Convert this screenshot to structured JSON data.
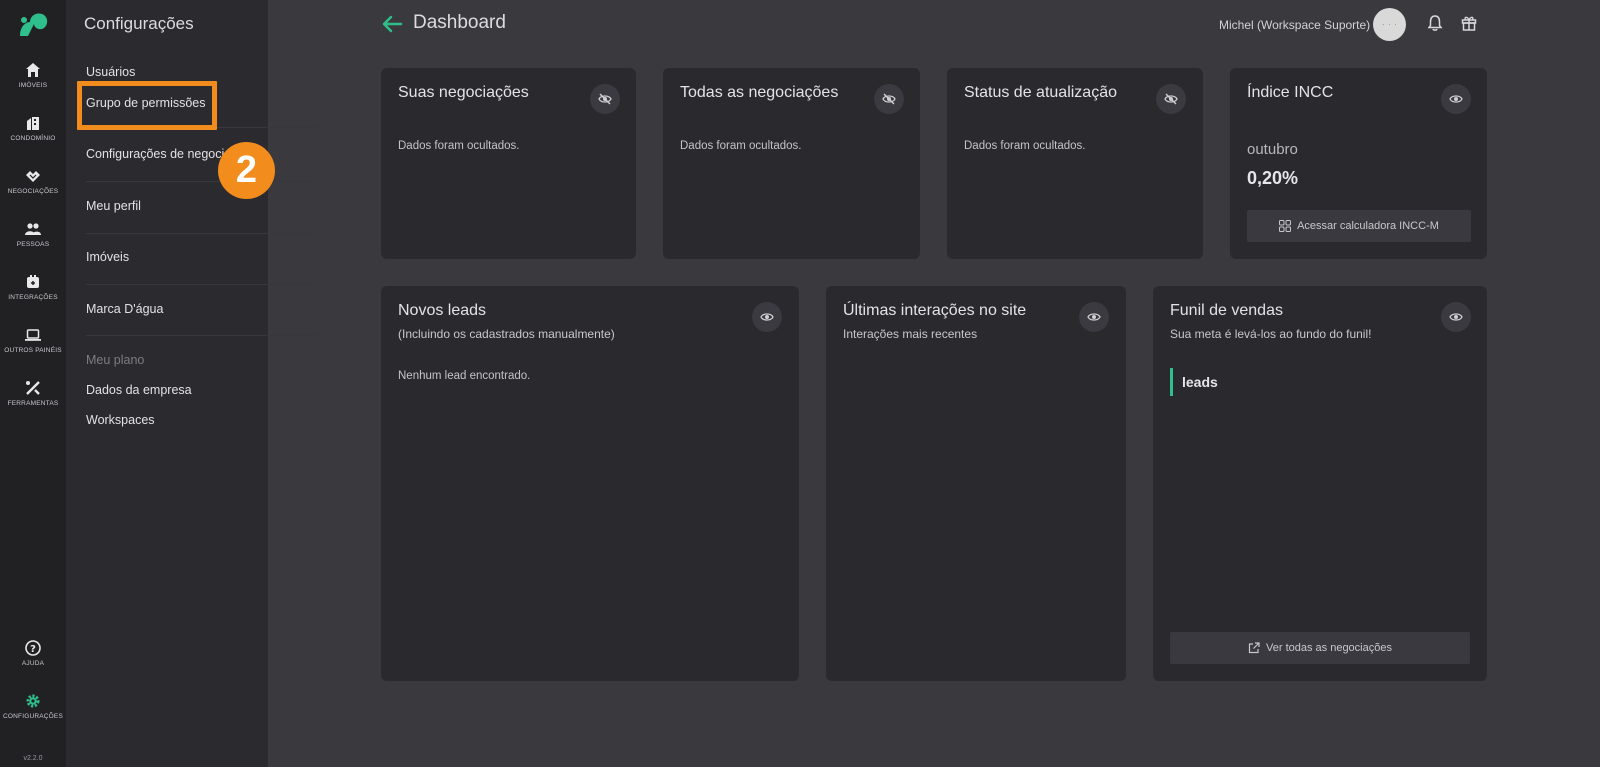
{
  "rail": {
    "items": [
      {
        "label": "Imóveis",
        "icon": "home-icon"
      },
      {
        "label": "Condomínio",
        "icon": "building-icon"
      },
      {
        "label": "Negociações",
        "icon": "handshake-icon"
      },
      {
        "label": "Pessoas",
        "icon": "people-icon"
      },
      {
        "label": "Integrações",
        "icon": "plug-icon"
      },
      {
        "label": "Outros painéis",
        "icon": "laptop-icon"
      },
      {
        "label": "Ferramentas",
        "icon": "tools-icon"
      }
    ],
    "help_label": "Ajuda",
    "settings_label": "Configurações",
    "version": "v2.2.0"
  },
  "sidebar": {
    "title": "Configurações",
    "links": [
      {
        "label": "Usuários"
      },
      {
        "label": "Grupo de permissões"
      },
      {
        "label": "Configurações de negoci"
      },
      {
        "label": "Meu perfil"
      },
      {
        "label": "Imóveis"
      },
      {
        "label": "Marca D'água"
      }
    ],
    "plan_section": "Meu plano",
    "plan_links": [
      {
        "label": "Dados da empresa"
      },
      {
        "label": "Workspaces"
      }
    ],
    "step_badge": "2"
  },
  "header": {
    "title": "Dashboard",
    "user_name": "Michel (Workspace Suporte)",
    "avatar_text": "· · ·"
  },
  "cards": {
    "suas_negociacoes": {
      "title": "Suas negociações",
      "message": "Dados foram ocultados."
    },
    "todas_negociacoes": {
      "title": "Todas as negociações",
      "message": "Dados foram ocultados."
    },
    "status_atualizacao": {
      "title": "Status de atualização",
      "message": "Dados foram ocultados."
    },
    "indice_incc": {
      "title": "Índice INCC",
      "month": "outubro",
      "value": "0,20%",
      "button": "Acessar calculadora INCC-M"
    },
    "novos_leads": {
      "title": "Novos leads",
      "subtitle": "(Incluindo os cadastrados manualmente)",
      "message": "Nenhum lead encontrado."
    },
    "ultimas_interacoes": {
      "title": "Últimas interações no site",
      "subtitle": "Interações mais recentes"
    },
    "funil_vendas": {
      "title": "Funil de vendas",
      "subtitle": "Sua meta é levá-los ao fundo do funil!",
      "stage": "leads",
      "button": "Ver todas as negociações"
    }
  },
  "colors": {
    "accent": "#2fbf8c",
    "highlight": "#f28c1c",
    "card_bg": "#2a292e",
    "page_bg": "#3a393e"
  }
}
